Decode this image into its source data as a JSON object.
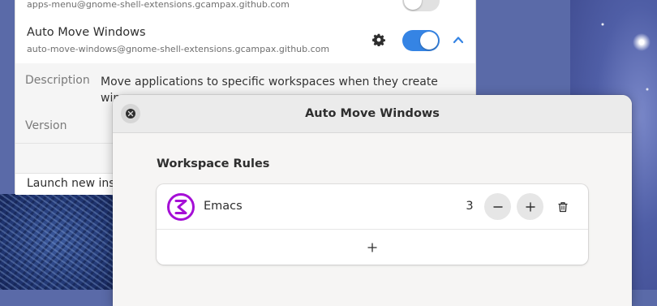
{
  "prefs": {
    "apps_menu_uuid": "apps-menu@gnome-shell-extensions.gcampax.github.com",
    "auto_move": {
      "name": "Auto Move Windows",
      "uuid": "auto-move-windows@gnome-shell-extensions.gcampax.github.com",
      "enabled": true
    },
    "details": {
      "description_label": "Description",
      "description_value": "Move applications to specific workspaces when they create",
      "description_overflow": "win",
      "version_label": "Version"
    },
    "launch_row_text": "Launch new insta"
  },
  "dialog": {
    "title": "Auto Move Windows",
    "section_title": "Workspace Rules",
    "rules": [
      {
        "app": "Emacs",
        "workspace": "3",
        "icon": "emacs-icon"
      }
    ]
  },
  "colors": {
    "accent": "#3584e4",
    "emacs": "#a50fd6"
  }
}
